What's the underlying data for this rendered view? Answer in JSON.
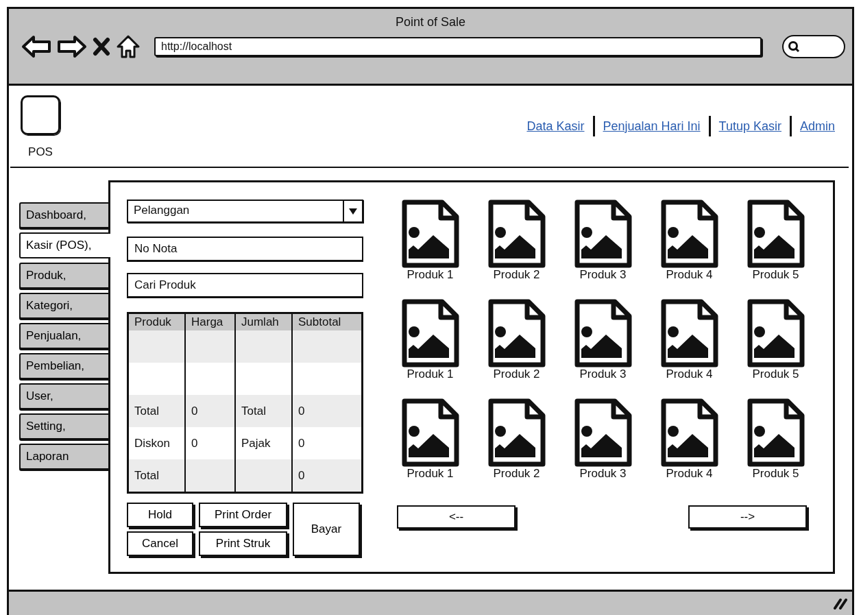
{
  "window": {
    "title": "Point of Sale"
  },
  "browser": {
    "address": "http://localhost"
  },
  "logo": {
    "label": "POS"
  },
  "header_links": [
    "Data Kasir",
    "Penjualan Hari Ini",
    "Tutup Kasir",
    "Admin"
  ],
  "sidebar": {
    "items": [
      {
        "label": "Dashboard,",
        "selected": false
      },
      {
        "label": "Kasir (POS),",
        "selected": true
      },
      {
        "label": "Produk,",
        "selected": false
      },
      {
        "label": "Kategori,",
        "selected": false
      },
      {
        "label": "Penjualan,",
        "selected": false
      },
      {
        "label": "Pembelian,",
        "selected": false
      },
      {
        "label": "User,",
        "selected": false
      },
      {
        "label": "Setting,",
        "selected": false
      },
      {
        "label": "Laporan",
        "selected": false
      }
    ]
  },
  "customer_select": {
    "value": "Pelanggan"
  },
  "invoice_field": {
    "value": "No Nota"
  },
  "product_search": {
    "value": "Cari Produk"
  },
  "table": {
    "columns": [
      "Produk",
      "Harga",
      "Jumlah",
      "Subtotal"
    ],
    "rows": [
      [
        null,
        null,
        null,
        null
      ],
      [
        null,
        null,
        null,
        null
      ],
      [
        "Total",
        "0",
        "Total",
        "0"
      ],
      [
        "Diskon",
        "0",
        "Pajak",
        "0"
      ],
      [
        "Total",
        null,
        null,
        "0"
      ]
    ]
  },
  "action_buttons": [
    {
      "label": "Hold",
      "kind": "small"
    },
    {
      "label": "Print Order",
      "kind": "small"
    },
    {
      "label": "Cancel",
      "kind": "small"
    },
    {
      "label": "Print Struk",
      "kind": "small"
    },
    {
      "label": "Bayar",
      "kind": "tall"
    }
  ],
  "product_grid": {
    "rows": [
      [
        "Produk 1",
        "Produk 2",
        "Produk 3",
        "Produk 4",
        "Produk 5"
      ],
      [
        "Produk 1",
        "Produk 2",
        "Produk 3",
        "Produk 4",
        "Produk 5"
      ],
      [
        "Produk 1",
        "Produk 2",
        "Produk 3",
        "Produk 4",
        "Produk 5"
      ]
    ]
  },
  "pager": {
    "previous": "<--",
    "next": "-->"
  }
}
